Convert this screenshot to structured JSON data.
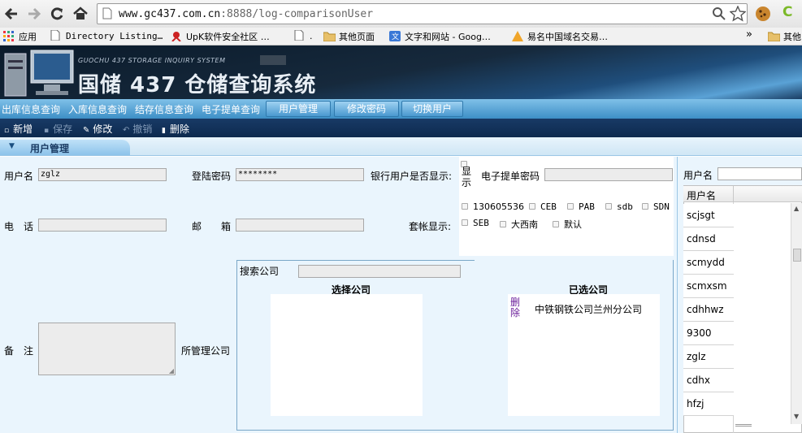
{
  "browser": {
    "url_host": "www.gc437.com.cn",
    "url_rest": ":8888/log-comparisonUser",
    "bookmarks": [
      {
        "label": "应用",
        "icon": "apps-grid-icon"
      },
      {
        "label": "Directory Listing…",
        "icon": "page-icon"
      },
      {
        "label": "UpK软件安全社区 …",
        "icon": "bookmark-logo-icon"
      },
      {
        "label": ".",
        "icon": "page-icon"
      },
      {
        "label": "其他页面",
        "icon": "folder-icon"
      },
      {
        "label": "文字和网站 - Goog…",
        "icon": "translate-icon"
      },
      {
        "label": "易名中国域名交易…",
        "icon": "domain-logo-icon"
      },
      {
        "label": "»",
        "icon": ""
      },
      {
        "label": "其他",
        "icon": "folder-icon"
      }
    ]
  },
  "banner": {
    "brand_small": "GUOCHU 437 STORAGE INQUIRY SYSTEM",
    "title": "国储 437 仓储查询系统"
  },
  "menu": {
    "items": [
      "出库信息查询",
      "入库信息查询",
      "结存信息查询",
      "电子提单查询"
    ],
    "buttons": [
      "用户管理",
      "修改密码",
      "切换用户"
    ]
  },
  "actions": [
    {
      "label": "新增",
      "enabled": true
    },
    {
      "label": "保存",
      "enabled": false
    },
    {
      "label": "修改",
      "enabled": true
    },
    {
      "label": "撤销",
      "enabled": false
    },
    {
      "label": "删除",
      "enabled": true
    }
  ],
  "section_title": "用户管理",
  "form": {
    "username_label": "用户名",
    "username_value": "zglz",
    "password_label": "登陆密码",
    "password_value": "********",
    "bank_show_label": "银行用户是否显示:",
    "bank_show_chk_label": "显示",
    "ebill_pwd_label": "电子提单密码",
    "phone_label": "电　话",
    "email_label": "邮　　箱",
    "account_show_label": "套帐显示:",
    "accounts": [
      "130605536",
      "CEB",
      "PAB",
      "sdb",
      "SDN",
      "SEB",
      "大西南",
      "默认"
    ],
    "remark_label": "备　注",
    "managed_label": "所管理公司",
    "search_company_label": "搜索公司",
    "select_company_label": "选择公司",
    "selected_company_label": "已选公司",
    "delete_link": "删除",
    "selected_companies": [
      "中铁钢铁公司兰州分公司"
    ]
  },
  "user_panel": {
    "filter_label": "用户名",
    "col_header": "用户名",
    "users": [
      "scjsgt",
      "cdnsd",
      "scmydd",
      "scmxsm",
      "cdhhwz",
      "9300",
      "zglz",
      "cdhx",
      "hfzj"
    ]
  }
}
